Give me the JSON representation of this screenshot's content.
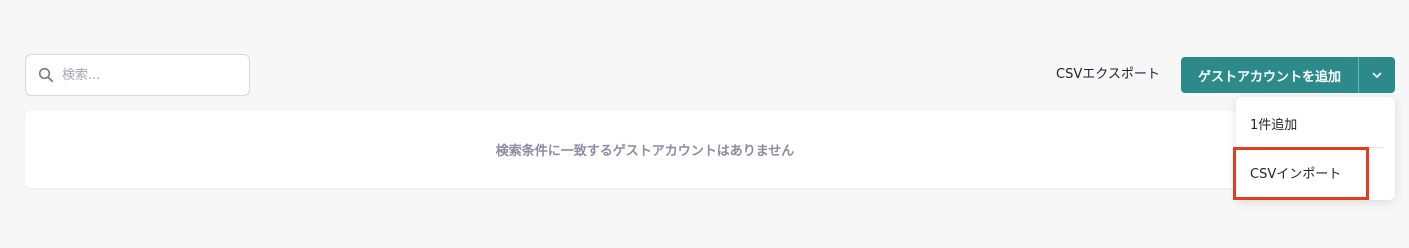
{
  "search": {
    "placeholder": "検索...",
    "value": "",
    "icon": "search-icon"
  },
  "toolbar": {
    "export_label": "CSVエクスポート",
    "add_label": "ゲストアカウントを追加",
    "caret_icon": "chevron-down-icon"
  },
  "results": {
    "empty_message": "検索条件に一致するゲストアカウントはありません"
  },
  "menu": {
    "items": [
      {
        "label": "1件追加"
      },
      {
        "label": "CSVインポート"
      }
    ]
  },
  "colors": {
    "accent": "#2c8b8a",
    "highlight": "#e63b1f",
    "background": "#f7f7f7",
    "muted_text": "#8c8ca3"
  }
}
